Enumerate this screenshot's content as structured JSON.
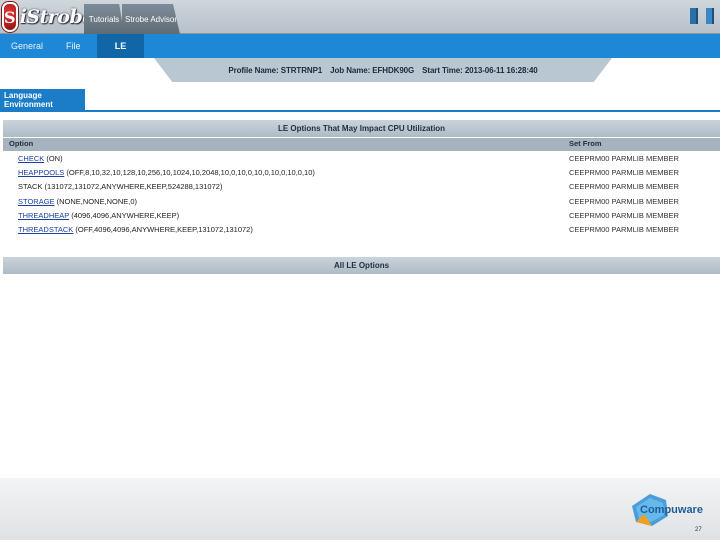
{
  "app": {
    "logo_mark": "S",
    "logo_text": "iStrobe",
    "logo_icon": "strobe-badge-icon"
  },
  "top_tabs": [
    {
      "label": "Tutorials"
    },
    {
      "label": "Strobe Advisor"
    }
  ],
  "top_icons": [
    "window-icon",
    "window-icon"
  ],
  "menu": [
    {
      "label": "General"
    },
    {
      "label": "File"
    },
    {
      "label": "LE"
    }
  ],
  "info": {
    "profile": "Profile Name: STRTRNP1",
    "job": "Job Name: EFHDK90G",
    "start": "Start Time: 2013-06-11 16:28:40"
  },
  "section_tab": "Language Environment",
  "panel1": {
    "title": "LE Options That May Impact CPU Utilization",
    "col_option": "Option",
    "col_setfrom": "Set From",
    "rows": [
      {
        "name": "CHECK",
        "args": " (ON)",
        "source": "CEEPRM00 PARMLIB MEMBER",
        "link": true
      },
      {
        "name": "HEAPPOOLS",
        "args": " (OFF,8,10,32,10,128,10,256,10,1024,10,2048,10,0,10,0,10,0,10,0,10,0,10)",
        "source": "CEEPRM00 PARMLIB MEMBER",
        "link": true
      },
      {
        "name": "STACK",
        "args": " (131072,131072,ANYWHERE,KEEP,524288,131072)",
        "source": "CEEPRM00 PARMLIB MEMBER",
        "link": false
      },
      {
        "name": "STORAGE",
        "args": " (NONE,NONE,NONE,0)",
        "source": "CEEPRM00 PARMLIB MEMBER",
        "link": true
      },
      {
        "name": "THREADHEAP",
        "args": " (4096,4096,ANYWHERE,KEEP)",
        "source": "CEEPRM00 PARMLIB MEMBER",
        "link": true
      },
      {
        "name": "THREADSTACK",
        "args": " (OFF,4096,4096,ANYWHERE,KEEP,131072,131072)",
        "source": "CEEPRM00 PARMLIB MEMBER",
        "link": true
      }
    ]
  },
  "panel2": {
    "title": "All LE Options"
  },
  "footer": {
    "brand": "Compuware",
    "page": "27"
  }
}
